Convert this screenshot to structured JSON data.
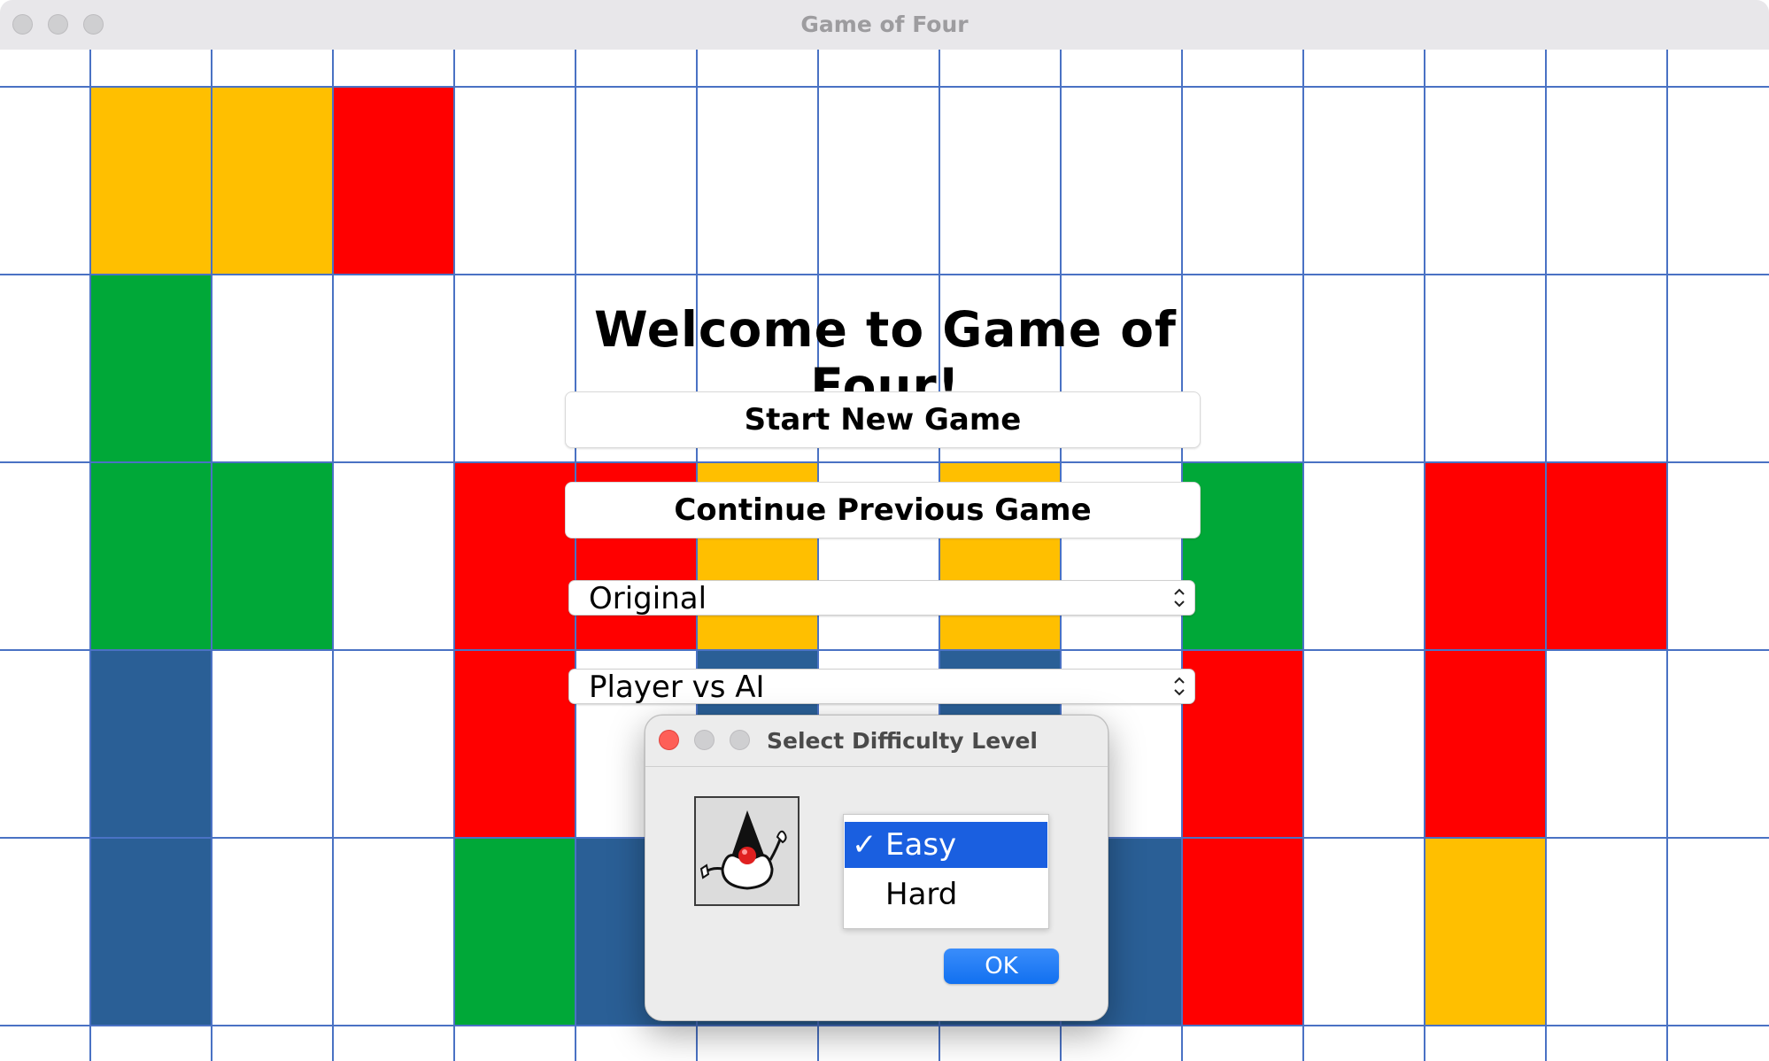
{
  "window": {
    "title": "Game of Four"
  },
  "board": {
    "colors": {
      "yellow": "#ffbf00",
      "red": "#ff0000",
      "green": "#00a838",
      "blue": "#2a5f96",
      "grid": "#4a72c4"
    },
    "tiles": [
      {
        "col": 1,
        "row": 0,
        "color": "yellow"
      },
      {
        "col": 2,
        "row": 0,
        "color": "yellow"
      },
      {
        "col": 3,
        "row": 0,
        "color": "red"
      },
      {
        "col": 1,
        "row": 1,
        "color": "green"
      },
      {
        "col": 1,
        "row": 2,
        "color": "green"
      },
      {
        "col": 2,
        "row": 2,
        "color": "green"
      },
      {
        "col": 4,
        "row": 2,
        "color": "red"
      },
      {
        "col": 5,
        "row": 2,
        "color": "red"
      },
      {
        "col": 6,
        "row": 2,
        "color": "yellow"
      },
      {
        "col": 8,
        "row": 2,
        "color": "yellow"
      },
      {
        "col": 10,
        "row": 2,
        "color": "green"
      },
      {
        "col": 12,
        "row": 2,
        "color": "red"
      },
      {
        "col": 13,
        "row": 2,
        "color": "red"
      },
      {
        "col": 1,
        "row": 3,
        "color": "blue"
      },
      {
        "col": 4,
        "row": 3,
        "color": "red"
      },
      {
        "col": 6,
        "row": 3,
        "color": "blue"
      },
      {
        "col": 8,
        "row": 3,
        "color": "blue"
      },
      {
        "col": 10,
        "row": 3,
        "color": "red"
      },
      {
        "col": 12,
        "row": 3,
        "color": "red"
      },
      {
        "col": 1,
        "row": 4,
        "color": "blue"
      },
      {
        "col": 4,
        "row": 4,
        "color": "green"
      },
      {
        "col": 5,
        "row": 4,
        "color": "blue"
      },
      {
        "col": 6,
        "row": 4,
        "color": "blue"
      },
      {
        "col": 7,
        "row": 4,
        "color": "blue"
      },
      {
        "col": 8,
        "row": 4,
        "color": "blue"
      },
      {
        "col": 9,
        "row": 4,
        "color": "blue"
      },
      {
        "col": 10,
        "row": 4,
        "color": "red"
      },
      {
        "col": 12,
        "row": 4,
        "color": "yellow"
      }
    ]
  },
  "menu": {
    "welcome": "Welcome to Game of Four!",
    "start_new_game": "Start New Game",
    "continue_previous_game": "Continue Previous Game",
    "variant_select": "Original",
    "mode_select": "Player vs AI"
  },
  "dialog": {
    "title": "Select Difficulty Level",
    "icon": "java-duke-icon",
    "options": [
      {
        "label": "Easy",
        "selected": true,
        "check": "✓"
      },
      {
        "label": "Hard",
        "selected": false,
        "check": ""
      }
    ],
    "ok_label": "OK",
    "accent": "#1a5fe0"
  }
}
